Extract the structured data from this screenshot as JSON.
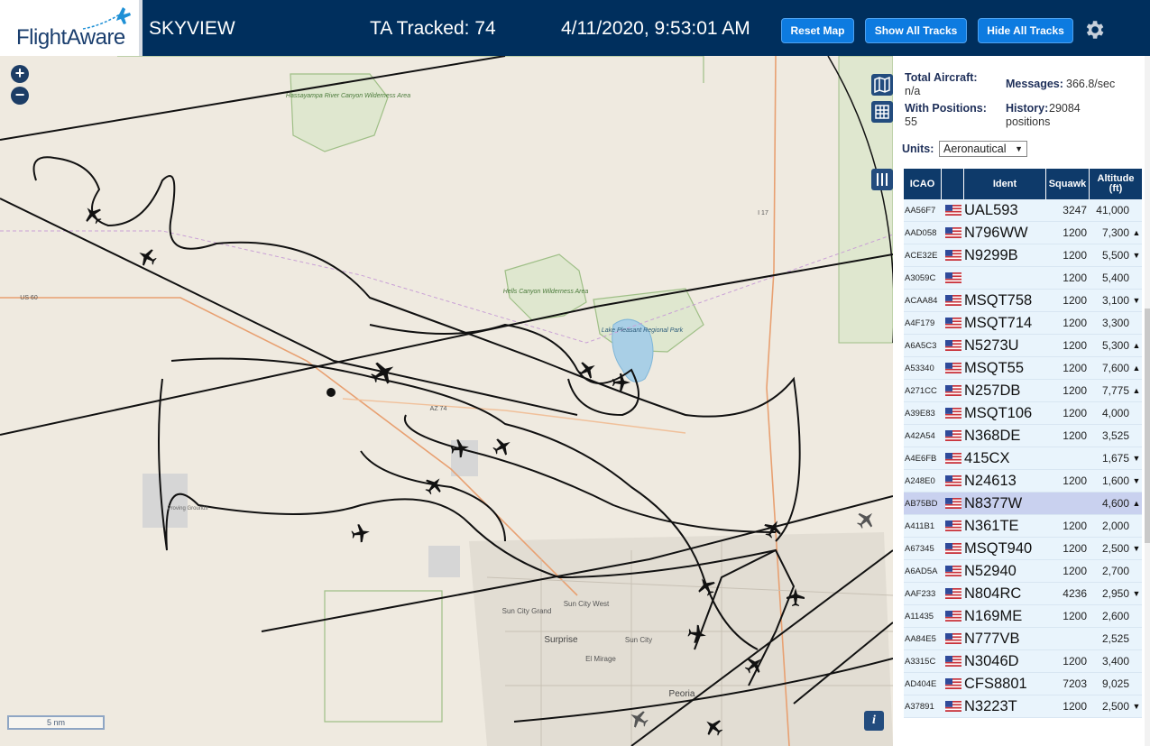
{
  "header": {
    "logo_text": "FlightAware",
    "site_name": "SKYVIEW",
    "tracked": "TA Tracked: 74",
    "datetime": "4/11/2020, 9:53:01 AM",
    "buttons": {
      "reset": "Reset Map",
      "show_all": "Show All Tracks",
      "hide_all": "Hide All Tracks"
    }
  },
  "map": {
    "zoom_in": "+",
    "zoom_out": "−",
    "scale_label": "5 nm",
    "info_label": "i",
    "labels": {
      "hassayampa": "Hassayampa River Canyon Wilderness Area",
      "hells_canyon": "Hells Canyon Wilderness Area",
      "lake_pleasant": "Lake Pleasant Regional Park",
      "sun_city_grand": "Sun City Grand",
      "sun_city_west": "Sun City West",
      "surprise": "Surprise",
      "sun_city": "Sun City",
      "el_mirage": "El Mirage",
      "peoria": "Peoria",
      "proving": "Proving Grounds",
      "us60": "US 60",
      "i17": "I 17",
      "az74": "AZ 74"
    }
  },
  "stats": {
    "total_aircraft_label": "Total Aircraft:",
    "total_aircraft_value": "n/a",
    "with_positions_label": "With Positions:",
    "with_positions_value": "55",
    "messages_label": "Messages:",
    "messages_value": "366.8/sec",
    "history_label": "History:",
    "history_value": "29084 positions",
    "units_label": "Units:",
    "units_value": "Aeronautical"
  },
  "table": {
    "headers": {
      "icao": "ICAO",
      "ident": "Ident",
      "squawk": "Squawk",
      "altitude": "Altitude (ft)"
    },
    "rows": [
      {
        "icao": "AA56F7",
        "ident": "UAL593",
        "squawk": "3247",
        "altitude": "41,000",
        "trend": ""
      },
      {
        "icao": "AAD058",
        "ident": "N796WW",
        "squawk": "1200",
        "altitude": "7,300",
        "trend": "▲"
      },
      {
        "icao": "ACE32E",
        "ident": "N9299B",
        "squawk": "1200",
        "altitude": "5,500",
        "trend": "▼"
      },
      {
        "icao": "A3059C",
        "ident": "",
        "squawk": "1200",
        "altitude": "5,400",
        "trend": ""
      },
      {
        "icao": "ACAA84",
        "ident": "MSQT758",
        "squawk": "1200",
        "altitude": "3,100",
        "trend": "▼"
      },
      {
        "icao": "A4F179",
        "ident": "MSQT714",
        "squawk": "1200",
        "altitude": "3,300",
        "trend": ""
      },
      {
        "icao": "A6A5C3",
        "ident": "N5273U",
        "squawk": "1200",
        "altitude": "5,300",
        "trend": "▲"
      },
      {
        "icao": "A53340",
        "ident": "MSQT55",
        "squawk": "1200",
        "altitude": "7,600",
        "trend": "▲"
      },
      {
        "icao": "A271CC",
        "ident": "N257DB",
        "squawk": "1200",
        "altitude": "7,775",
        "trend": "▲"
      },
      {
        "icao": "A39E83",
        "ident": "MSQT106",
        "squawk": "1200",
        "altitude": "4,000",
        "trend": ""
      },
      {
        "icao": "A42A54",
        "ident": "N368DE",
        "squawk": "1200",
        "altitude": "3,525",
        "trend": ""
      },
      {
        "icao": "A4E6FB",
        "ident": "415CX",
        "squawk": "",
        "altitude": "1,675",
        "trend": "▼"
      },
      {
        "icao": "A248E0",
        "ident": "N24613",
        "squawk": "1200",
        "altitude": "1,600",
        "trend": "▼"
      },
      {
        "icao": "AB75BD",
        "ident": "N8377W",
        "squawk": "",
        "altitude": "4,600",
        "trend": "▲"
      },
      {
        "icao": "A411B1",
        "ident": "N361TE",
        "squawk": "1200",
        "altitude": "2,000",
        "trend": ""
      },
      {
        "icao": "A67345",
        "ident": "MSQT940",
        "squawk": "1200",
        "altitude": "2,500",
        "trend": "▼"
      },
      {
        "icao": "A6AD5A",
        "ident": "N52940",
        "squawk": "1200",
        "altitude": "2,700",
        "trend": ""
      },
      {
        "icao": "AAF233",
        "ident": "N804RC",
        "squawk": "4236",
        "altitude": "2,950",
        "trend": "▼"
      },
      {
        "icao": "A11435",
        "ident": "N169ME",
        "squawk": "1200",
        "altitude": "2,600",
        "trend": ""
      },
      {
        "icao": "AA84E5",
        "ident": "N777VB",
        "squawk": "",
        "altitude": "2,525",
        "trend": ""
      },
      {
        "icao": "A3315C",
        "ident": "N3046D",
        "squawk": "1200",
        "altitude": "3,400",
        "trend": ""
      },
      {
        "icao": "AD404E",
        "ident": "CFS8801",
        "squawk": "7203",
        "altitude": "9,025",
        "trend": ""
      },
      {
        "icao": "A37891",
        "ident": "N3223T",
        "squawk": "1200",
        "altitude": "2,500",
        "trend": "▼"
      }
    ]
  }
}
